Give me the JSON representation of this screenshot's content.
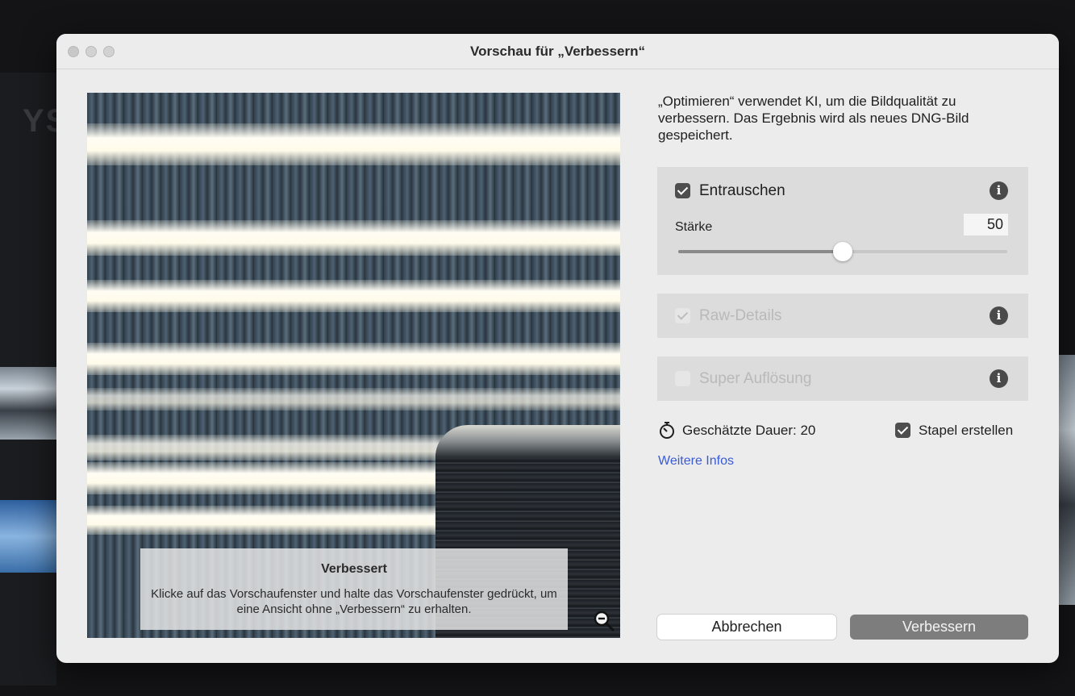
{
  "window": {
    "title": "Vorschau für „Verbessern“"
  },
  "background": {
    "partial_text": "YS"
  },
  "preview": {
    "overlay_title": "Verbessert",
    "overlay_text": "Klicke auf das Vorschaufenster und halte das Vorschaufenster gedrückt, um eine Ansicht ohne „Verbessern“ zu erhalten.",
    "zoom_icon": "zoom-out-icon"
  },
  "description": "„Optimieren“ verwendet KI, um die Bildqualität zu verbessern. Das Ergebnis wird als neues DNG-Bild gespeichert.",
  "options": {
    "denoise": {
      "label": "Entrauschen",
      "checked": true,
      "enabled": true,
      "strength_label": "Stärke",
      "strength_value": "50",
      "strength_fraction": 0.5
    },
    "raw_details": {
      "label": "Raw-Details",
      "checked": true,
      "enabled": false
    },
    "super_resolution": {
      "label": "Super Auflösung",
      "checked": false,
      "enabled": false
    }
  },
  "estimate": {
    "text": "Geschätzte Dauer: 20",
    "icon": "stopwatch-icon"
  },
  "stack": {
    "label": "Stapel erstellen",
    "checked": true
  },
  "more_info": "Weitere Infos",
  "buttons": {
    "cancel": "Abbrechen",
    "enhance": "Verbessern"
  }
}
